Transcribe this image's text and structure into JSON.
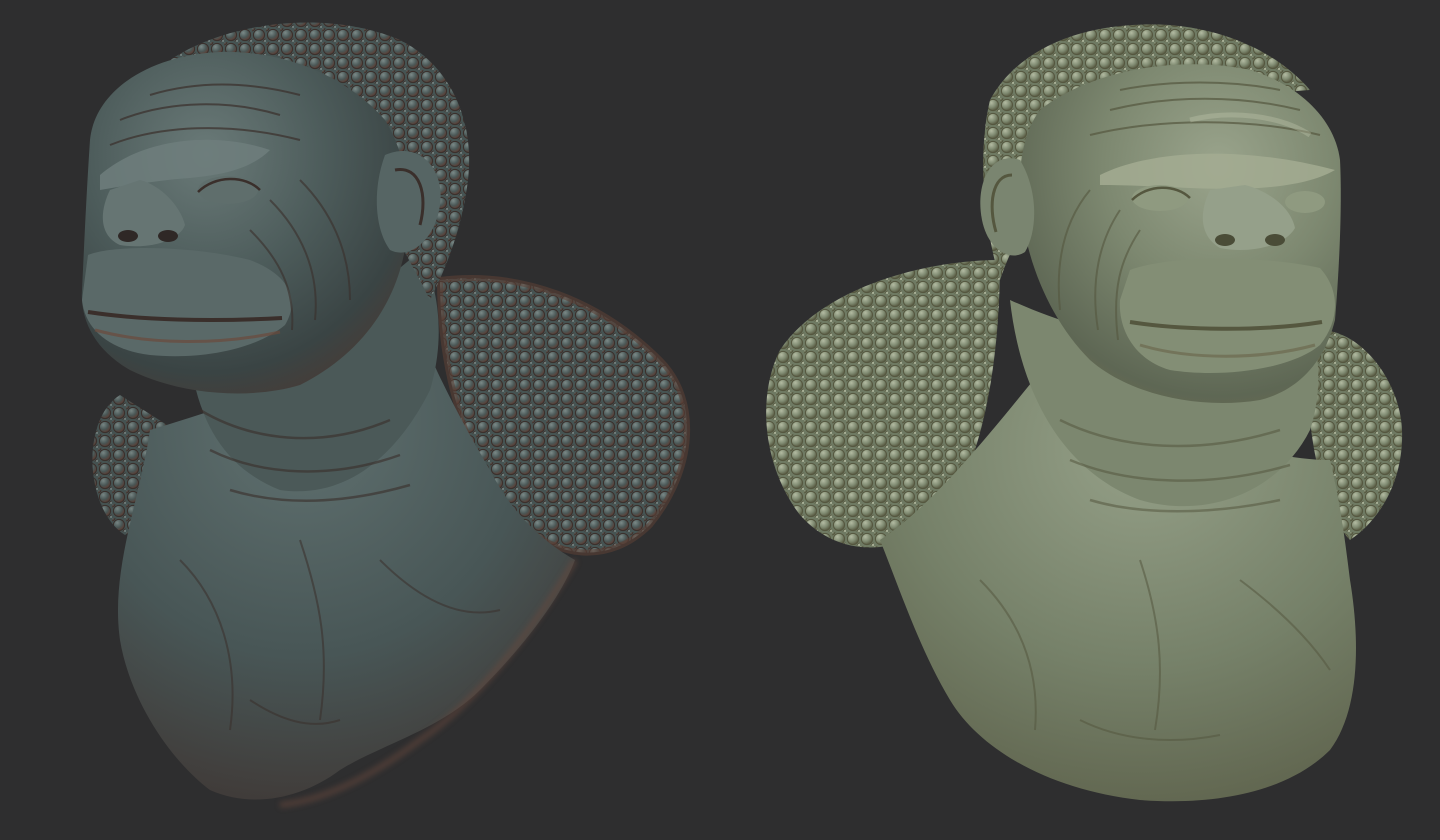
{
  "scene": {
    "background_color": "#2e2e2f",
    "renders": [
      {
        "name": "bust-render-dark-material",
        "material_color": "#51615f",
        "rim_color": "#6b4a3c"
      },
      {
        "name": "bust-render-light-material",
        "material_color": "#7d8870",
        "rim_color": "#9a8a63"
      }
    ]
  }
}
